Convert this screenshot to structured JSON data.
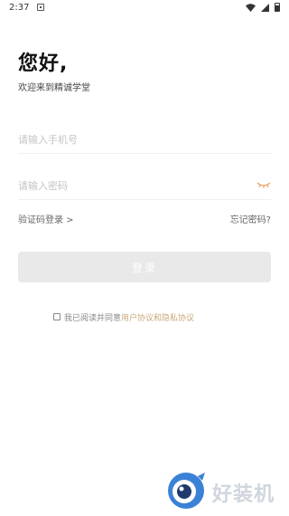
{
  "status_bar": {
    "time": "2:37",
    "icons": [
      "app-notification-icon",
      "wifi-icon",
      "signal-icon",
      "battery-icon"
    ]
  },
  "header": {
    "greeting": "您好,",
    "welcome": "欢迎来到精诚学堂"
  },
  "form": {
    "phone_placeholder": "请输入手机号",
    "phone_value": "",
    "password_placeholder": "请输入密码",
    "password_value": "",
    "password_toggle_icon": "eye-closed-icon"
  },
  "links": {
    "sms_login": "验证码登录 >",
    "forgot_password": "忘记密码?"
  },
  "login_button": {
    "label": "登录"
  },
  "agreement": {
    "prefix": "我已阅读并同意",
    "policy": "用户协议和隐私协议"
  },
  "watermark": {
    "text": "好装机"
  },
  "colors": {
    "accent": "#e9a46a",
    "policy": "#c8a97a",
    "button_disabled": "#e9e9e9",
    "watermark_blue": "#3b82d6"
  }
}
